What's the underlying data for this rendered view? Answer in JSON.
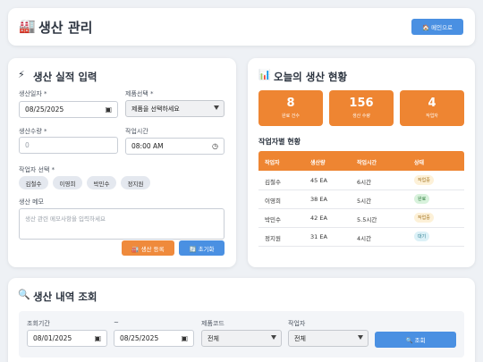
{
  "header": {
    "title": "생산 관리",
    "title_icon": "factory-icon",
    "home_button": "🏠 메인으로"
  },
  "input_form": {
    "title": "생산 실적 입력",
    "title_icon": "lightning-icon",
    "date_label": "생산일자 *",
    "date_value": "08/25/2025",
    "product_label": "제품선택 *",
    "product_value": "제품을 선택하세요",
    "qty_label": "생산수량 *",
    "qty_placeholder": "0",
    "time_label": "작업시간",
    "time_value": "08:00 AM",
    "worker_label": "작업자 선택 *",
    "workers": [
      "김철수",
      "이영희",
      "박민수",
      "정지원"
    ],
    "memo_label": "생산 메모",
    "memo_placeholder": "생산 관련 메모사항을 입력하세요",
    "register_button": "🏭 생산 등록",
    "reset_button": "🔄 초기화"
  },
  "today_status": {
    "title": "오늘의 생산 현황",
    "title_icon": "bar-chart-icon",
    "stats": [
      {
        "value": "8",
        "caption": "완료 건수"
      },
      {
        "value": "156",
        "caption": "생산 수량"
      },
      {
        "value": "4",
        "caption": "작업자"
      }
    ],
    "table_title": "작업자별 현황",
    "columns": [
      "작업자",
      "생산량",
      "작업시간",
      "상태"
    ],
    "rows": [
      {
        "worker": "김철수",
        "qty": "45 EA",
        "time": "6시간",
        "status": "작업중"
      },
      {
        "worker": "이영희",
        "qty": "38 EA",
        "time": "5시간",
        "status": "완료"
      },
      {
        "worker": "박민수",
        "qty": "42 EA",
        "time": "5.5시간",
        "status": "작업중"
      },
      {
        "worker": "정지원",
        "qty": "31 EA",
        "time": "4시간",
        "status": "대기"
      }
    ]
  },
  "history": {
    "title": "생산 내역 조회",
    "title_icon": "magnifier-icon",
    "period_label": "조회기간",
    "tilde": "~",
    "start_date": "08/01/2025",
    "end_date": "08/25/2025",
    "product_code_label": "제품코드",
    "product_code_value": "전체",
    "worker_label": "작업자",
    "worker_value": "전체",
    "search_button": "🔍 조회"
  }
}
